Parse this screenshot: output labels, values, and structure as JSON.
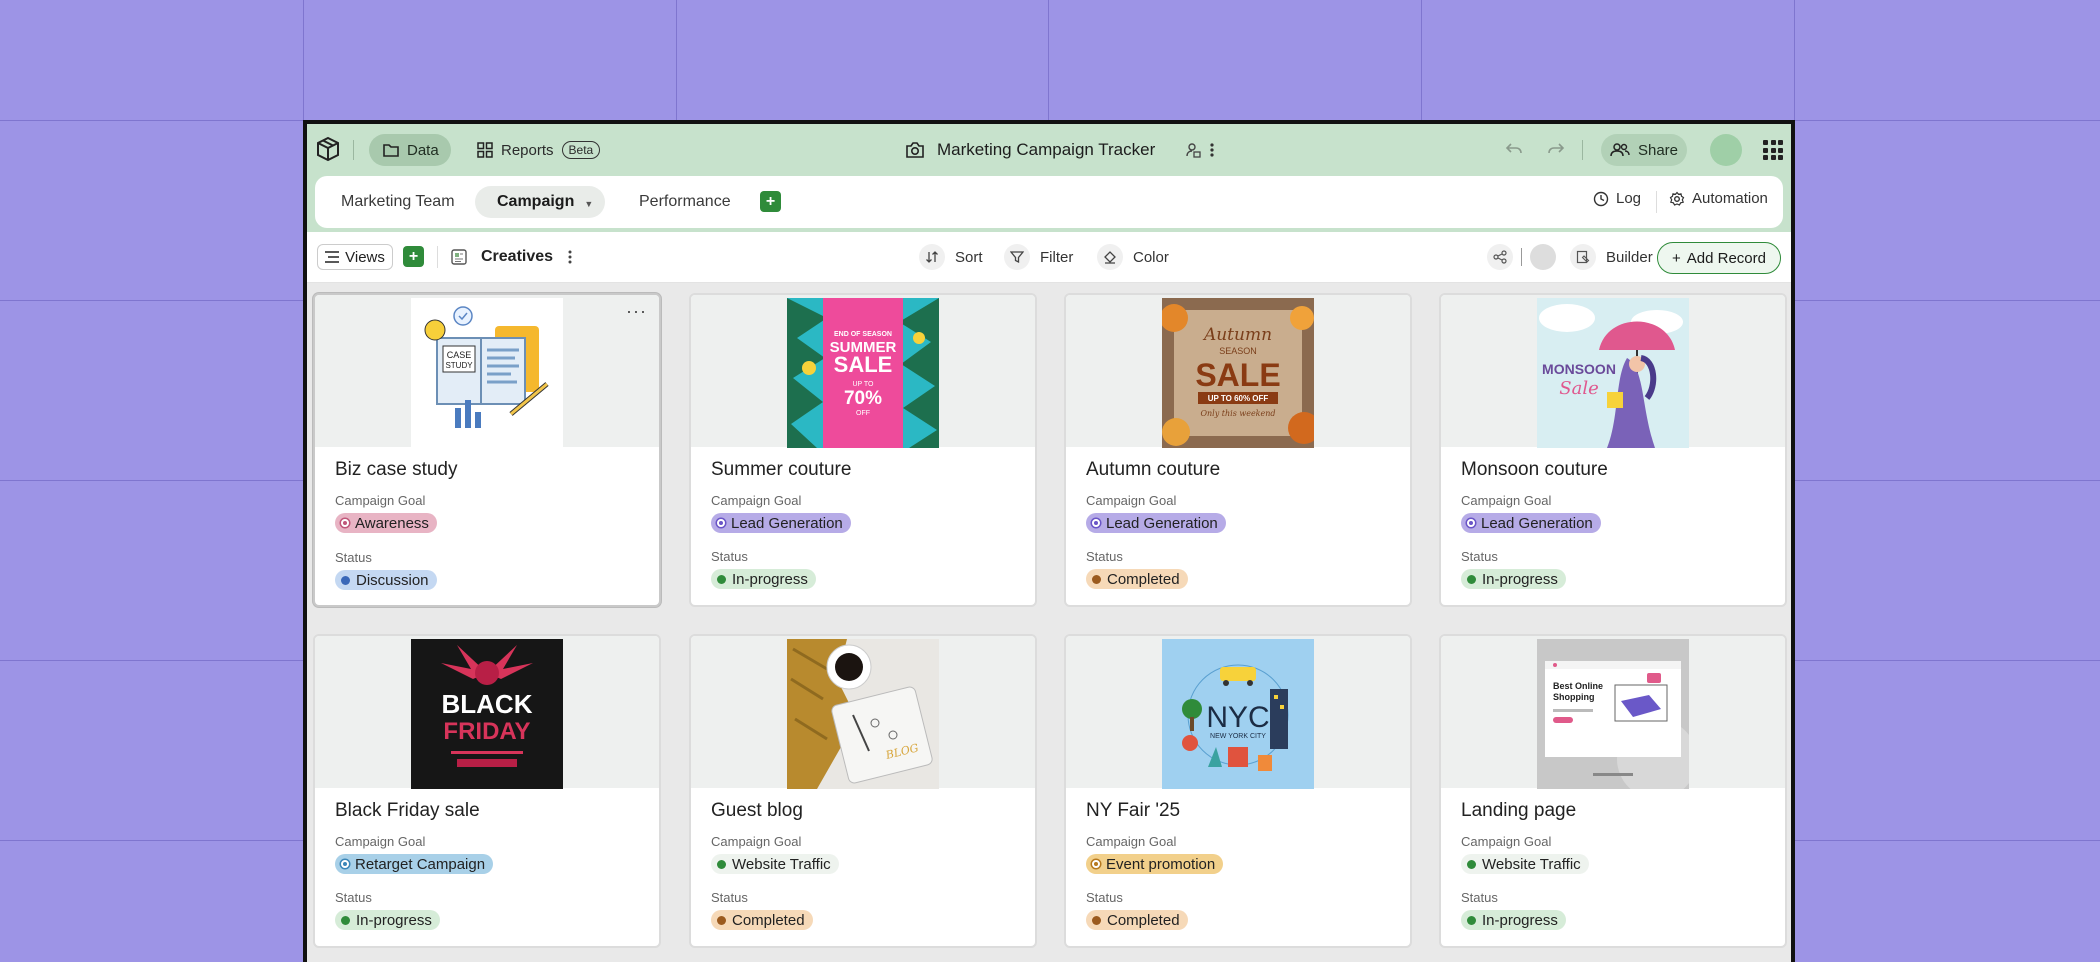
{
  "app": {
    "title": "Marketing Campaign Tracker",
    "nav": {
      "data_label": "Data",
      "reports_label": "Reports",
      "beta_label": "Beta",
      "share_label": "Share"
    }
  },
  "tabs": {
    "items": [
      {
        "label": "Marketing Team"
      },
      {
        "label": "Campaign"
      },
      {
        "label": "Performance"
      }
    ],
    "active": "Campaign",
    "log_label": "Log",
    "automation_label": "Automation"
  },
  "toolbar": {
    "views_label": "Views",
    "view_name": "Creatives",
    "sort_label": "Sort",
    "filter_label": "Filter",
    "color_label": "Color",
    "builder_label": "Builder",
    "add_record_label": "Add Record"
  },
  "field_labels": {
    "goal": "Campaign Goal",
    "status": "Status"
  },
  "cards": [
    {
      "title": "Biz case study",
      "goal": "Awareness",
      "status": "Discussion",
      "image": "case-study-illustration"
    },
    {
      "title": "Summer couture",
      "goal": "Lead Generation",
      "status": "In-progress",
      "image": "summer-sale-poster",
      "poster_text": {
        "line1": "END OF SEASON",
        "line2": "SUMMER",
        "line3": "SALE",
        "line4": "UP TO",
        "line5": "70%",
        "line6": "OFF"
      }
    },
    {
      "title": "Autumn couture",
      "goal": "Lead Generation",
      "status": "Completed",
      "image": "autumn-sale-poster",
      "poster_text": {
        "line1": "Autumn",
        "line2": "SEASON",
        "line3": "SALE",
        "line4": "UP TO 60% OFF",
        "line5": "Only this weekend"
      }
    },
    {
      "title": "Monsoon couture",
      "goal": "Lead Generation",
      "status": "In-progress",
      "image": "monsoon-sale-illustration",
      "poster_text": {
        "line1": "MONSOON",
        "line2": "Sale"
      }
    },
    {
      "title": "Black Friday sale",
      "goal": "Retarget Campaign",
      "status": "In-progress",
      "image": "black-friday-poster",
      "poster_text": {
        "line1": "BLACK",
        "line2": "FRIDAY"
      }
    },
    {
      "title": "Guest blog",
      "goal": "Website Traffic",
      "status": "Completed",
      "image": "coffee-notebook-photo",
      "poster_text": {
        "line1": "BLOG"
      }
    },
    {
      "title": "NY Fair '25",
      "goal": "Event promotion",
      "status": "Completed",
      "image": "nyc-illustration",
      "poster_text": {
        "line1": "NYC",
        "line2": "NEW YORK CITY"
      }
    },
    {
      "title": "Landing page",
      "goal": "Website Traffic",
      "status": "In-progress",
      "image": "landing-page-mockup",
      "poster_text": {
        "line1": "Best Online",
        "line2": "Shopping"
      }
    }
  ],
  "chip_colors": {
    "Awareness": {
      "bg": "#e8b4c4",
      "dot": "#c0577a",
      "ring": true
    },
    "Lead Generation": {
      "bg": "#b6abe7",
      "dot": "#6a55c7",
      "ring": true
    },
    "Retarget Campaign": {
      "bg": "#a8d0e8",
      "dot": "#3b86b8",
      "ring": true
    },
    "Website Traffic": {
      "bg": "#eef3ee",
      "dot": "#2f8b3a",
      "ring": false
    },
    "Event promotion": {
      "bg": "#f2d08b",
      "dot": "#b7791f",
      "ring": true
    },
    "Discussion": {
      "bg": "#c4d8f2",
      "dot": "#3a68b8",
      "ring": false
    },
    "In-progress": {
      "bg": "#d6ecd8",
      "dot": "#2f8b3a",
      "ring": false
    },
    "Completed": {
      "bg": "#f6d9b8",
      "dot": "#9b5a1e",
      "ring": false
    }
  }
}
